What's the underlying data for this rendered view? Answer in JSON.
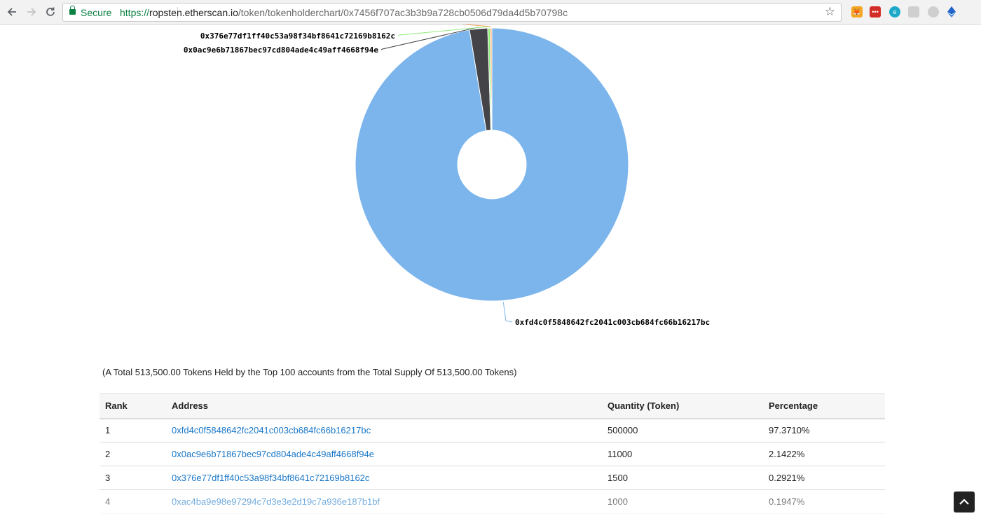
{
  "browser": {
    "secure_label": "Secure",
    "url_scheme": "https://",
    "url_host": "ropsten.etherscan.io",
    "url_path": "/token/tokenholderchart/0x7456f707ac3b3b9a728cb0506d79da4d5b70798c",
    "extension_icons": [
      "metamask-icon",
      "lastpass-icon",
      "translate-icon",
      "cast-icon",
      "ublock-icon",
      "ethereum-icon"
    ]
  },
  "chart_data": {
    "type": "pie",
    "slices": [
      {
        "label": "0xfd4c0f5848642fc2041c003cb684fc66b16217bc",
        "value": 97.371,
        "color": "#7cb5ec"
      },
      {
        "label": "0x0ac9e6b71867bec97cd804ade4c49aff4668f94e",
        "value": 2.1422,
        "color": "#434348"
      },
      {
        "label": "0x376e77df1ff40c53a98f34bf8641c72169b8162c",
        "value": 0.2921,
        "color": "#90ed7d"
      },
      {
        "label": "0xac4ba9e98e97294c7d3e3e2d19c7a936e187b1bf",
        "value": 0.1947,
        "color": "#f7a35c"
      }
    ]
  },
  "summary": "(A Total 513,500.00 Tokens Held by the Top 100 accounts from the Total Supply Of 513,500.00 Tokens)",
  "table": {
    "headers": {
      "rank": "Rank",
      "address": "Address",
      "quantity": "Quantity (Token)",
      "percentage": "Percentage"
    },
    "rows": [
      {
        "rank": "1",
        "address": "0xfd4c0f5848642fc2041c003cb684fc66b16217bc",
        "quantity": "500000",
        "percentage": "97.3710%"
      },
      {
        "rank": "2",
        "address": "0x0ac9e6b71867bec97cd804ade4c49aff4668f94e",
        "quantity": "11000",
        "percentage": "2.1422%"
      },
      {
        "rank": "3",
        "address": "0x376e77df1ff40c53a98f34bf8641c72169b8162c",
        "quantity": "1500",
        "percentage": "0.2921%"
      },
      {
        "rank": "4",
        "address": "0xac4ba9e98e97294c7d3e3e2d19c7a936e187b1bf",
        "quantity": "1000",
        "percentage": "0.1947%"
      }
    ]
  }
}
